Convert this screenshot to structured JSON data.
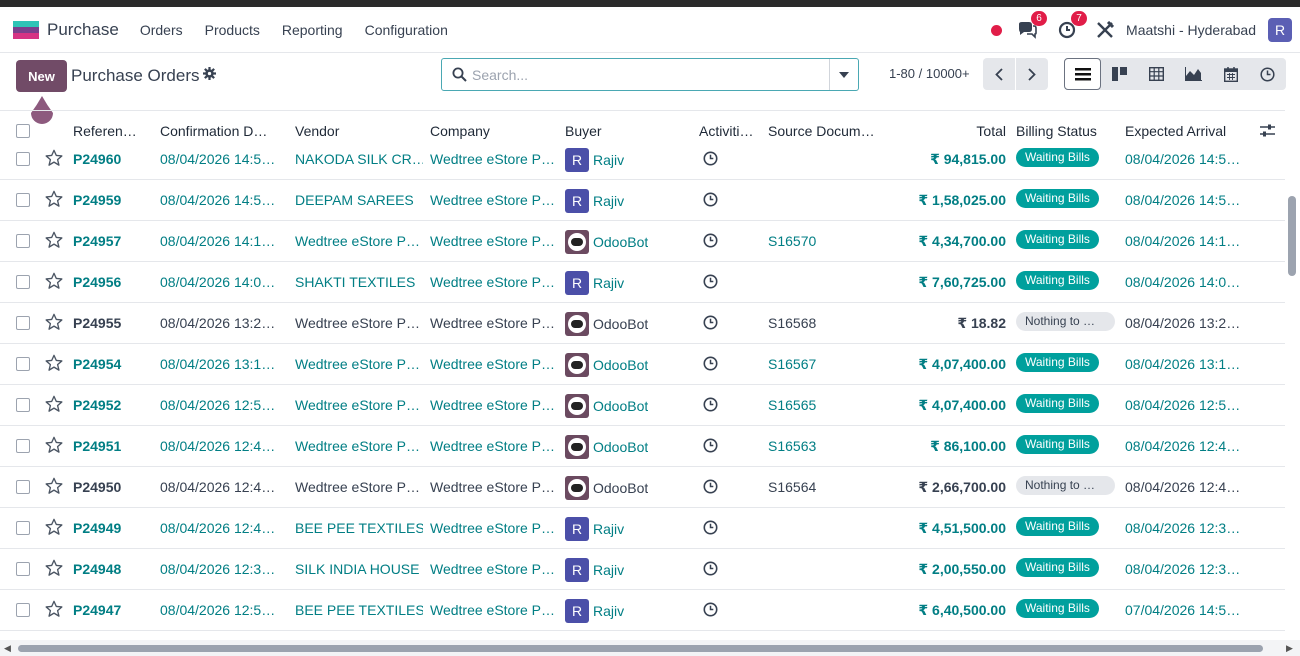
{
  "navbar": {
    "app_name": "Purchase",
    "menu": [
      "Orders",
      "Products",
      "Reporting",
      "Configuration"
    ],
    "messages_count": "6",
    "activities_count": "7",
    "company": "Maatshi - Hyderabad",
    "user_initial": "R"
  },
  "control": {
    "new_label": "New",
    "title": "Purchase Orders",
    "search_placeholder": "Search...",
    "pager": "1-80 / 10000+"
  },
  "columns": {
    "reference": "Referen…",
    "confirmation": "Confirmation D…",
    "vendor": "Vendor",
    "company": "Company",
    "buyer": "Buyer",
    "activities": "Activiti…",
    "source": "Source Docum…",
    "total": "Total",
    "billing": "Billing Status",
    "arrival": "Expected Arrival"
  },
  "rows": [
    {
      "ref": "P24960",
      "date": "08/04/2026 14:5…",
      "vendor": "NAKODA SILK CR…",
      "company": "Wedtree eStore P…",
      "buyer": "Rajiv",
      "buyer_type": "R",
      "source": "",
      "total": "₹ 94,815.00",
      "status": "Waiting Bills",
      "arrival": "08/04/2026 14:5…",
      "linked": true
    },
    {
      "ref": "P24959",
      "date": "08/04/2026 14:5…",
      "vendor": "DEEPAM SAREES",
      "company": "Wedtree eStore P…",
      "buyer": "Rajiv",
      "buyer_type": "R",
      "source": "",
      "total": "₹ 1,58,025.00",
      "status": "Waiting Bills",
      "arrival": "08/04/2026 14:5…",
      "linked": true
    },
    {
      "ref": "P24957",
      "date": "08/04/2026 14:1…",
      "vendor": "Wedtree eStore P…",
      "company": "Wedtree eStore P…",
      "buyer": "OdooBot",
      "buyer_type": "bot",
      "source": "S16570",
      "total": "₹ 4,34,700.00",
      "status": "Waiting Bills",
      "arrival": "08/04/2026 14:1…",
      "linked": true
    },
    {
      "ref": "P24956",
      "date": "08/04/2026 14:0…",
      "vendor": "SHAKTI TEXTILES",
      "company": "Wedtree eStore P…",
      "buyer": "Rajiv",
      "buyer_type": "R",
      "source": "",
      "total": "₹ 7,60,725.00",
      "status": "Waiting Bills",
      "arrival": "08/04/2026 14:0…",
      "linked": true
    },
    {
      "ref": "P24955",
      "date": "08/04/2026 13:2…",
      "vendor": "Wedtree eStore P…",
      "company": "Wedtree eStore P…",
      "buyer": "OdooBot",
      "buyer_type": "bot",
      "source": "S16568",
      "total": "₹ 18.82",
      "status": "Nothing to …",
      "arrival": "08/04/2026 13:2…",
      "linked": false
    },
    {
      "ref": "P24954",
      "date": "08/04/2026 13:1…",
      "vendor": "Wedtree eStore P…",
      "company": "Wedtree eStore P…",
      "buyer": "OdooBot",
      "buyer_type": "bot",
      "source": "S16567",
      "total": "₹ 4,07,400.00",
      "status": "Waiting Bills",
      "arrival": "08/04/2026 13:1…",
      "linked": true
    },
    {
      "ref": "P24952",
      "date": "08/04/2026 12:5…",
      "vendor": "Wedtree eStore P…",
      "company": "Wedtree eStore P…",
      "buyer": "OdooBot",
      "buyer_type": "bot",
      "source": "S16565",
      "total": "₹ 4,07,400.00",
      "status": "Waiting Bills",
      "arrival": "08/04/2026 12:5…",
      "linked": true
    },
    {
      "ref": "P24951",
      "date": "08/04/2026 12:4…",
      "vendor": "Wedtree eStore P…",
      "company": "Wedtree eStore P…",
      "buyer": "OdooBot",
      "buyer_type": "bot",
      "source": "S16563",
      "total": "₹ 86,100.00",
      "status": "Waiting Bills",
      "arrival": "08/04/2026 12:4…",
      "linked": true
    },
    {
      "ref": "P24950",
      "date": "08/04/2026 12:4…",
      "vendor": "Wedtree eStore P…",
      "company": "Wedtree eStore P…",
      "buyer": "OdooBot",
      "buyer_type": "bot",
      "source": "S16564",
      "total": "₹ 2,66,700.00",
      "status": "Nothing to …",
      "arrival": "08/04/2026 12:4…",
      "linked": false
    },
    {
      "ref": "P24949",
      "date": "08/04/2026 12:4…",
      "vendor": "BEE PEE TEXTILES",
      "company": "Wedtree eStore P…",
      "buyer": "Rajiv",
      "buyer_type": "R",
      "source": "",
      "total": "₹ 4,51,500.00",
      "status": "Waiting Bills",
      "arrival": "08/04/2026 12:3…",
      "linked": true
    },
    {
      "ref": "P24948",
      "date": "08/04/2026 12:3…",
      "vendor": "SILK INDIA HOUSE",
      "company": "Wedtree eStore P…",
      "buyer": "Rajiv",
      "buyer_type": "R",
      "source": "",
      "total": "₹ 2,00,550.00",
      "status": "Waiting Bills",
      "arrival": "08/04/2026 12:3…",
      "linked": true
    },
    {
      "ref": "P24947",
      "date": "08/04/2026 12:5…",
      "vendor": "BEE PEE TEXTILES",
      "company": "Wedtree eStore P…",
      "buyer": "Rajiv",
      "buyer_type": "R",
      "source": "",
      "total": "₹ 6,40,500.00",
      "status": "Waiting Bills",
      "arrival": "07/04/2026 14:5…",
      "linked": true
    }
  ],
  "colors": {
    "brand": "#714b67",
    "link": "#017e84",
    "waiting_badge": "#00a09d",
    "notification": "#e11d48"
  }
}
